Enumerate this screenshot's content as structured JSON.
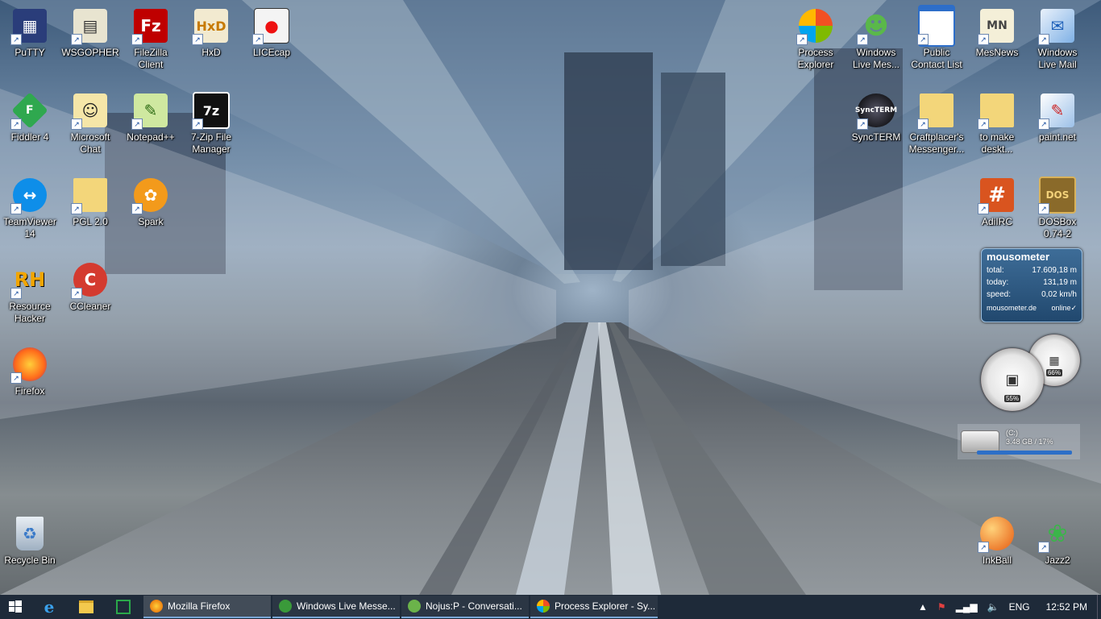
{
  "desktop": {
    "icons": [
      {
        "label": "PuTTY"
      },
      {
        "label": "WSGOPHER"
      },
      {
        "label": "FileZilla Client"
      },
      {
        "label": "HxD"
      },
      {
        "label": "LICEcap"
      },
      {
        "label": "Fiddler 4"
      },
      {
        "label": "Microsoft Chat"
      },
      {
        "label": "Notepad++"
      },
      {
        "label": "7-Zip File Manager"
      },
      {
        "label": "TeamViewer 14"
      },
      {
        "label": "PGL 2.0"
      },
      {
        "label": "Spark"
      },
      {
        "label": "Resource Hacker"
      },
      {
        "label": "CCleaner"
      },
      {
        "label": "Firefox"
      },
      {
        "label": "Recycle Bin"
      },
      {
        "label": "Process Explorer"
      },
      {
        "label": "Windows Live Mes..."
      },
      {
        "label": "Public Contact List"
      },
      {
        "label": "MesNews"
      },
      {
        "label": "Windows Live Mail"
      },
      {
        "label": "SyncTERM"
      },
      {
        "label": "Craftplacer's Messenger..."
      },
      {
        "label": "to make deskt..."
      },
      {
        "label": "paint.net"
      },
      {
        "label": "AdiIRC"
      },
      {
        "label": "DOSBox 0.74-2"
      },
      {
        "label": "InkBall"
      },
      {
        "label": "Jazz2"
      }
    ]
  },
  "mousometer": {
    "title": "mousometer",
    "total_label": "total:",
    "total": "17.609,18 m",
    "today_label": "today:",
    "today": "131,19 m",
    "speed_label": "speed:",
    "speed": "0,02 km/h",
    "site": "mousometer.de",
    "status": "online✓"
  },
  "gauges": {
    "cpu": "55%",
    "mem": "66%"
  },
  "drive": {
    "name": "(C:)",
    "usage": "3.48 GB / 17%",
    "used_fraction": 0.17
  },
  "taskbar": {
    "tasks": [
      {
        "label": "Mozilla Firefox",
        "color": "#e66000"
      },
      {
        "label": "Windows Live Messe...",
        "color": "#3a9a3a"
      },
      {
        "label": "Nojus:P - Conversati...",
        "color": "#6bb34a"
      },
      {
        "label": "Process Explorer - Sy...",
        "color": "#3f79c8"
      }
    ],
    "tray": {
      "lang": "ENG",
      "time": "12:52 PM"
    }
  }
}
